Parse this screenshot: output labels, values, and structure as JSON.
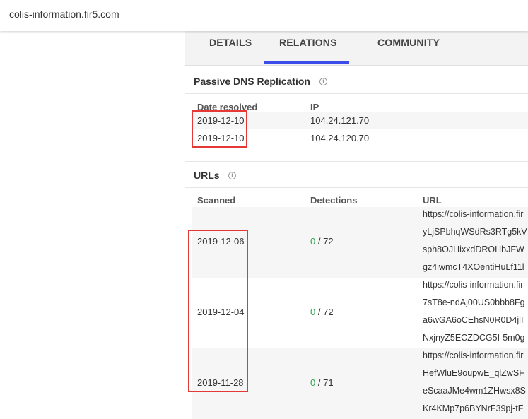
{
  "topbar": {
    "domain": "colis-information.fir5.com"
  },
  "tabs": [
    {
      "label": "DETAILS"
    },
    {
      "label": "RELATIONS",
      "active": true
    },
    {
      "label": "COMMUNITY"
    }
  ],
  "passive_dns": {
    "title": "Passive DNS Replication",
    "col_date": "Date resolved",
    "col_ip": "IP",
    "rows": [
      {
        "date": "2019-12-10",
        "ip": "104.24.121.70"
      },
      {
        "date": "2019-12-10",
        "ip": "104.24.120.70"
      }
    ]
  },
  "urls": {
    "title": "URLs",
    "col_scanned": "Scanned",
    "col_detections": "Detections",
    "col_url": "URL",
    "rows": [
      {
        "scanned": "2019-12-06",
        "det_good": "0",
        "det_total": "/ 72",
        "url_lines": [
          "https://colis-information.fir",
          "yLjSPbhqWSdRs3RTg5kV",
          "sph8OJHixxdDROHbJFW",
          "gz4iwmcT4XOentiHuLf11l"
        ]
      },
      {
        "scanned": "2019-12-04",
        "det_good": "0",
        "det_total": "/ 72",
        "url_lines": [
          "https://colis-information.fir",
          "7sT8e-ndAj00US0bbb8Fg",
          "a6wGA6oCEhsN0R0D4jlI",
          "NxjnyZ5ECZDCG5I-5m0g"
        ]
      },
      {
        "scanned": "2019-11-28",
        "det_good": "0",
        "det_total": "/ 71",
        "url_lines": [
          "https://colis-information.fir",
          "HefWluE9oupwE_qlZwSF",
          "eScaaJMe4wm1ZHwsx8S",
          "Kr4KMp7p6BYNrF39pj-tF"
        ]
      }
    ]
  },
  "colors": {
    "accent": "#3b4ce8",
    "highlight_box": "#e53935",
    "detection_ok": "#2da44e"
  }
}
